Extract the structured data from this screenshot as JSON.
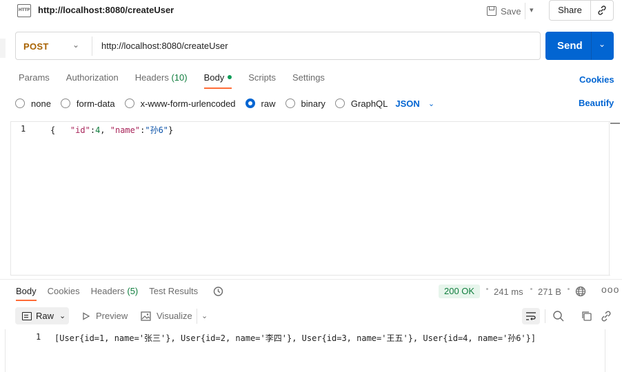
{
  "header": {
    "http_icon_text": "HTTP",
    "title": "http://localhost:8080/createUser",
    "save_label": "Save",
    "share_label": "Share"
  },
  "request": {
    "method": "POST",
    "url": "http://localhost:8080/createUser",
    "send_label": "Send"
  },
  "request_tabs": [
    {
      "label": "Params"
    },
    {
      "label": "Authorization"
    },
    {
      "label": "Headers",
      "count": "(10)"
    },
    {
      "label": "Body",
      "active": true
    },
    {
      "label": "Scripts"
    },
    {
      "label": "Settings"
    }
  ],
  "cookies_label": "Cookies",
  "body_types": [
    {
      "label": "none",
      "checked": false
    },
    {
      "label": "form-data",
      "checked": false
    },
    {
      "label": "x-www-form-urlencoded",
      "checked": false
    },
    {
      "label": "raw",
      "checked": true
    },
    {
      "label": "binary",
      "checked": false
    },
    {
      "label": "GraphQL",
      "checked": false
    }
  ],
  "body_format": "JSON",
  "beautify_label": "Beautify",
  "editor": {
    "line_number": "1",
    "open_brace": "{",
    "key_id": "\"id\"",
    "colon1": ":",
    "val_id": "4",
    "comma": ", ",
    "key_name": "\"name\"",
    "colon2": ":",
    "val_name": "\"孙6\"",
    "close_brace": "}"
  },
  "response_tabs": [
    {
      "label": "Body",
      "active": true
    },
    {
      "label": "Cookies"
    },
    {
      "label": "Headers",
      "count": "(5)"
    },
    {
      "label": "Test Results"
    }
  ],
  "response_meta": {
    "status": "200 OK",
    "time": "241 ms",
    "size": "271 B",
    "more": "ooo"
  },
  "response_toolbar": {
    "raw_label": "Raw",
    "preview_label": "Preview",
    "visualize_label": "Visualize"
  },
  "response_body": {
    "line_number": "1",
    "text": "[User{id=1, name='张三'}, User{id=2, name='李四'}, User{id=3, name='王五'}, User{id=4, name='孙6'}]"
  },
  "colors": {
    "accent": "#0265d2",
    "method": "#a86200",
    "active_tab": "#ff6c37",
    "status_ok": "#0f7d3d"
  }
}
